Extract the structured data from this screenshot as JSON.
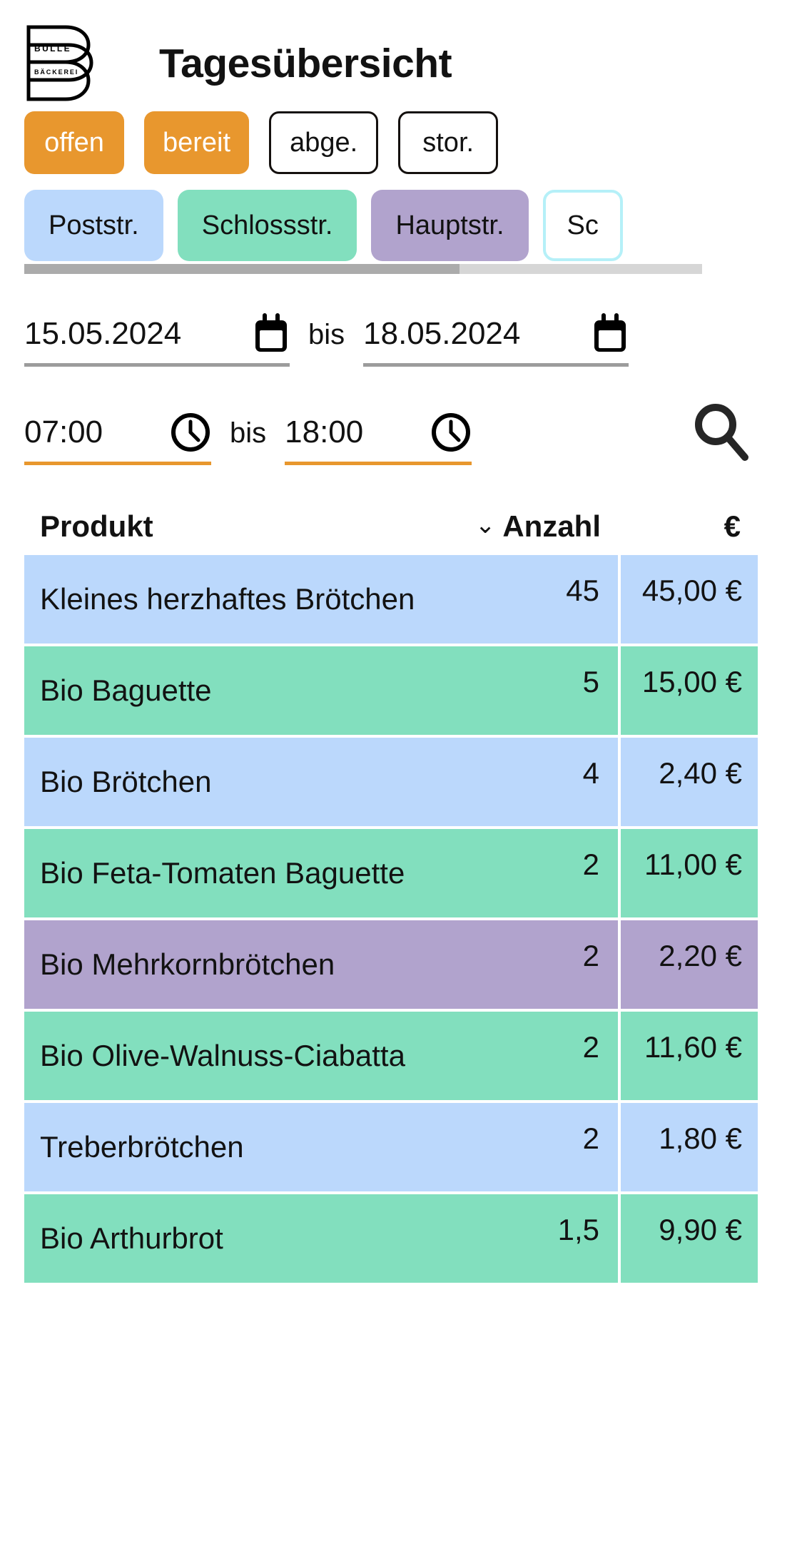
{
  "header": {
    "title": "Tagesübersicht",
    "logo_line1": "BULLE",
    "logo_line2": "BÄCKEREI"
  },
  "status_filters": [
    {
      "label": "offen",
      "state": "active"
    },
    {
      "label": "bereit",
      "state": "active"
    },
    {
      "label": "abge.",
      "state": "inactive"
    },
    {
      "label": "stor.",
      "state": "inactive"
    }
  ],
  "locations": [
    {
      "label": "Poststr.",
      "color": "#bbd8fc"
    },
    {
      "label": "Schlossstr.",
      "color": "#82dfbe"
    },
    {
      "label": "Hauptstr.",
      "color": "#b1a3cd"
    },
    {
      "label": "Sc",
      "color": "#ffffff"
    }
  ],
  "filters": {
    "date_from": "15.05.2024",
    "date_to": "18.05.2024",
    "time_from": "07:00",
    "time_to": "18:00",
    "separator": "bis",
    "search_label": "Suchen"
  },
  "table": {
    "headers": {
      "product": "Produkt",
      "count": "Anzahl",
      "price": "€",
      "sort_caret": "⌄"
    },
    "rows": [
      {
        "product": "Kleines herzhaftes Brötchen",
        "count": "45",
        "price": "45,00 €",
        "color": "blue"
      },
      {
        "product": "Bio Baguette",
        "count": "5",
        "price": "15,00 €",
        "color": "green"
      },
      {
        "product": "Bio Brötchen",
        "count": "4",
        "price": "2,40 €",
        "color": "blue"
      },
      {
        "product": "Bio Feta-Tomaten Baguette",
        "count": "2",
        "price": "11,00 €",
        "color": "green"
      },
      {
        "product": "Bio Mehrkornbrötchen",
        "count": "2",
        "price": "2,20 €",
        "color": "purple"
      },
      {
        "product": "Bio Olive-Walnuss-Ciabatta",
        "count": "2",
        "price": "11,60 €",
        "color": "green"
      },
      {
        "product": "Treberbrötchen",
        "count": "2",
        "price": "1,80 €",
        "color": "blue"
      },
      {
        "product": "Bio Arthurbrot",
        "count": "1,5",
        "price": "9,90 €",
        "color": "green"
      }
    ]
  },
  "colors": {
    "accent_orange": "#e8972e",
    "row_blue": "#bbd8fc",
    "row_green": "#82dfbe",
    "row_purple": "#b1a3cd",
    "ghost_border": "#b5f0f8"
  }
}
